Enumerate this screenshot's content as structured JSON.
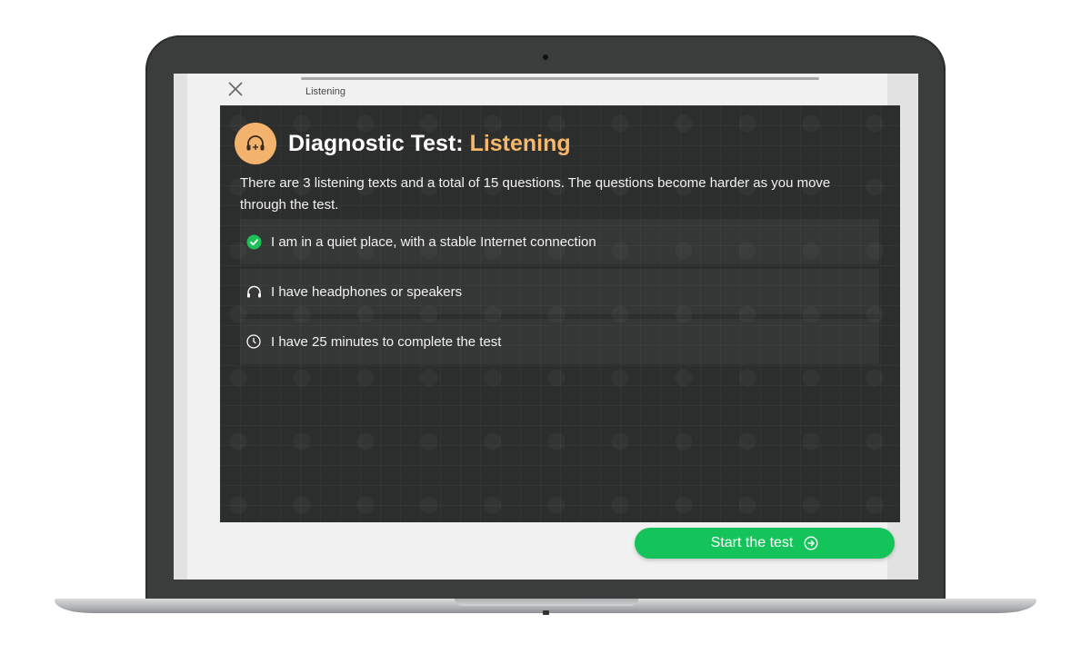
{
  "topbar": {
    "section_label": "Listening",
    "progress": 0
  },
  "header": {
    "title_prefix": "Diagnostic Test: ",
    "title_accent": "Listening",
    "badge_icon": "headphones-icon"
  },
  "description": "There are 3 listening texts and a total of 15 questions. The questions become harder as you move through the test.",
  "checklist": [
    {
      "icon": "check-circle-icon",
      "label": "I am in a quiet place, with a stable Internet connection",
      "checked": true
    },
    {
      "icon": "headphones-icon",
      "label": "I have headphones or speakers",
      "checked": false
    },
    {
      "icon": "clock-icon",
      "label": "I have 25 minutes to complete the test",
      "checked": false
    }
  ],
  "start_button": {
    "label": "Start the test",
    "icon": "arrow-right-circle-icon"
  },
  "colors": {
    "accent_orange": "#f7b86c",
    "start_green": "#14c45a",
    "panel_bg": "#2c2d2d",
    "check_green": "#1fbf58"
  }
}
